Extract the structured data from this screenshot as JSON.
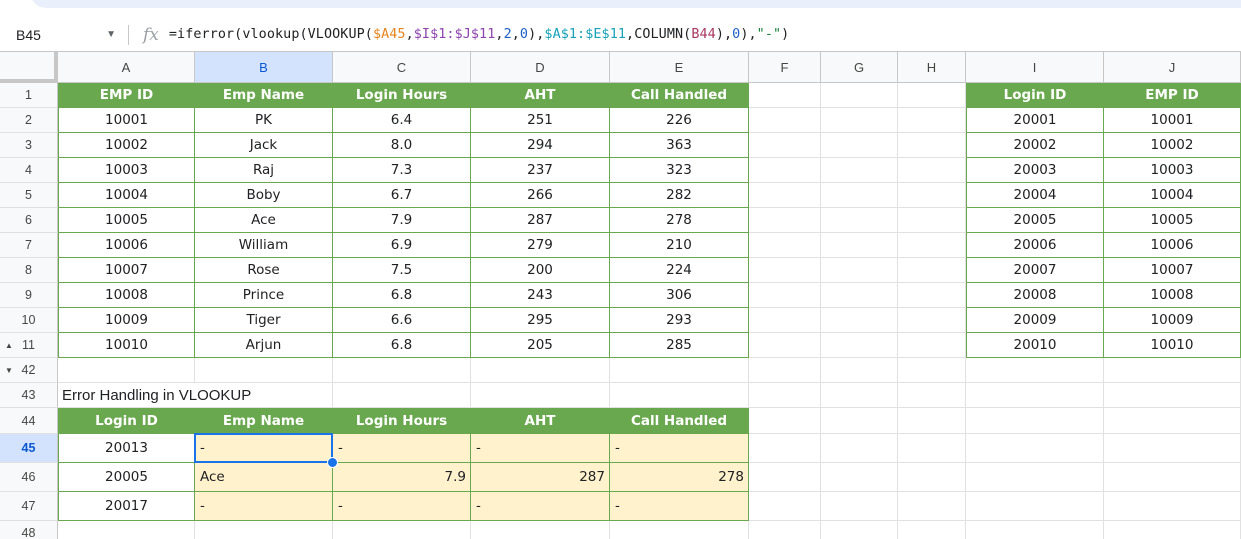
{
  "formula_bar": {
    "name_box": "B45",
    "fx_label": "fx",
    "formula_parts": [
      {
        "text": "=iferror(vlookup(VLOOKUP(",
        "color": "default"
      },
      {
        "text": "$A45",
        "color": "orange"
      },
      {
        "text": ",",
        "color": "default"
      },
      {
        "text": "$I$1:$J$11",
        "color": "purple"
      },
      {
        "text": ",",
        "color": "default"
      },
      {
        "text": "2",
        "color": "num"
      },
      {
        "text": ",",
        "color": "default"
      },
      {
        "text": "0",
        "color": "num"
      },
      {
        "text": "),",
        "color": "default"
      },
      {
        "text": "$A$1:$E$11",
        "color": "teal"
      },
      {
        "text": ",COLUMN(",
        "color": "default"
      },
      {
        "text": "B44",
        "color": "maroon"
      },
      {
        "text": "),",
        "color": "default"
      },
      {
        "text": "0",
        "color": "num"
      },
      {
        "text": "),",
        "color": "default"
      },
      {
        "text": "\"-\"",
        "color": "green"
      },
      {
        "text": ")",
        "color": "default"
      }
    ]
  },
  "columns": [
    "A",
    "B",
    "C",
    "D",
    "E",
    "F",
    "G",
    "H",
    "I",
    "J"
  ],
  "selected_column": "B",
  "selected_row": "45",
  "colors": {
    "header_green": "#6aa84f",
    "result_fill": "#fff2cc",
    "selection_blue": "#1a73e8"
  },
  "main_table": {
    "headers": [
      "EMP ID",
      "Emp Name",
      "Login Hours",
      "AHT",
      "Call Handled"
    ],
    "rows": [
      [
        "10001",
        "PK",
        "6.4",
        "251",
        "226"
      ],
      [
        "10002",
        "Jack",
        "8.0",
        "294",
        "363"
      ],
      [
        "10003",
        "Raj",
        "7.3",
        "237",
        "323"
      ],
      [
        "10004",
        "Boby",
        "6.7",
        "266",
        "282"
      ],
      [
        "10005",
        "Ace",
        "7.9",
        "287",
        "278"
      ],
      [
        "10006",
        "William",
        "6.9",
        "279",
        "210"
      ],
      [
        "10007",
        "Rose",
        "7.5",
        "200",
        "224"
      ],
      [
        "10008",
        "Prince",
        "6.8",
        "243",
        "306"
      ],
      [
        "10009",
        "Tiger",
        "6.6",
        "295",
        "293"
      ],
      [
        "10010",
        "Arjun",
        "6.8",
        "205",
        "285"
      ]
    ]
  },
  "lookup_table": {
    "headers": [
      "Login ID",
      "EMP ID"
    ],
    "rows": [
      [
        "20001",
        "10001"
      ],
      [
        "20002",
        "10002"
      ],
      [
        "20003",
        "10003"
      ],
      [
        "20004",
        "10004"
      ],
      [
        "20005",
        "10005"
      ],
      [
        "20006",
        "10006"
      ],
      [
        "20007",
        "10007"
      ],
      [
        "20008",
        "10008"
      ],
      [
        "20009",
        "10009"
      ],
      [
        "20010",
        "10010"
      ]
    ]
  },
  "row_numbers_top": [
    "1",
    "2",
    "3",
    "4",
    "5",
    "6",
    "7",
    "8",
    "9",
    "10",
    "11"
  ],
  "row_numbers_bottom": [
    "42",
    "43",
    "44",
    "45",
    "46",
    "47",
    "48"
  ],
  "hidden_rows_markers": {
    "up": "▲",
    "down": "▼"
  },
  "error_section": {
    "title": "Error Handling in VLOOKUP",
    "headers": [
      "Login ID",
      "Emp Name",
      "Login Hours",
      "AHT",
      "Call Handled"
    ],
    "rows": [
      [
        "20013",
        "-",
        "-",
        "-",
        "-"
      ],
      [
        "20005",
        "Ace",
        "7.9",
        "287",
        "278"
      ],
      [
        "20017",
        "-",
        "-",
        "-",
        "-"
      ]
    ]
  }
}
